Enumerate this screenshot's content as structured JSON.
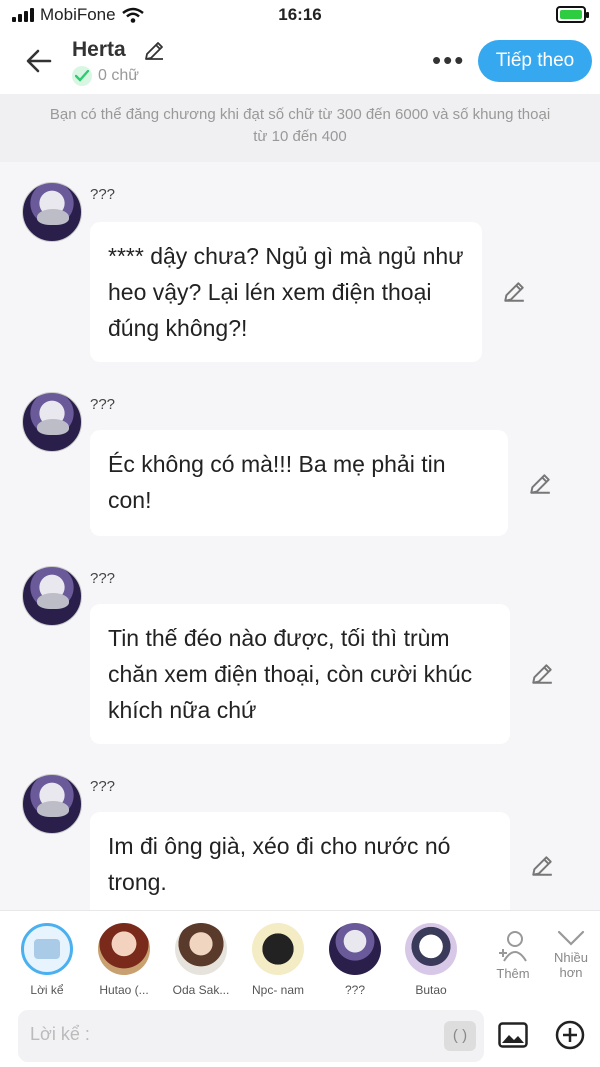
{
  "status": {
    "carrier": "MobiFone",
    "time": "16:16"
  },
  "header": {
    "title": "Herta",
    "char_count": "0 chữ",
    "next_label": "Tiếp theo"
  },
  "notice": {
    "line1": "Bạn có thể đăng chương khi đạt số chữ từ 300 đến 6000 và số khung thoại",
    "line2": "từ 10 đến 400"
  },
  "messages": [
    {
      "name": "???",
      "text": "**** dậy chưa? Ngủ gì mà ngủ như heo vậy? Lại lén xem điện thoại đúng không?!"
    },
    {
      "name": "???",
      "text": "Éc không có mà!!! Ba mẹ phải tin con!"
    },
    {
      "name": "???",
      "text": "Tin thế đéo nào được, tối thì trùm chăn xem điện thoại, còn cười khúc khích nữa chứ"
    },
    {
      "name": "???",
      "text": "Im đi ông già, xéo đi cho nước nó trong."
    }
  ],
  "characters": [
    {
      "label": "Lời kể"
    },
    {
      "label": "Hutao (..."
    },
    {
      "label": "Oda Sak..."
    },
    {
      "label": "Npc- nam"
    },
    {
      "label": "???"
    },
    {
      "label": "Butao"
    }
  ],
  "actions": {
    "add_label": "Thêm",
    "more_label_1": "Nhiều",
    "more_label_2": "hơn"
  },
  "input": {
    "placeholder": "Lời kể :",
    "paren": "( )"
  },
  "colors": {
    "accent": "#35a8f0",
    "check": "#2ecc71"
  }
}
